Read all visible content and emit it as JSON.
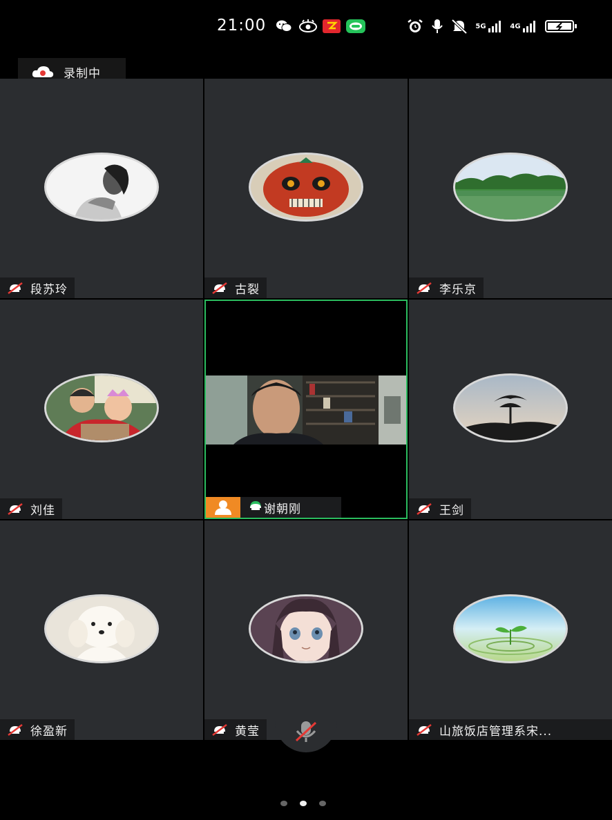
{
  "status_bar": {
    "time": "21:00",
    "network_1": "5G",
    "network_2": "4G"
  },
  "recording": {
    "label": "录制中"
  },
  "tiles": [
    {
      "name": "段苏玲",
      "avatar_icon": "portrait-woman-avatar"
    },
    {
      "name": "古裂",
      "avatar_icon": "tribal-mask-avatar"
    },
    {
      "name": "李乐京",
      "avatar_icon": "lake-landscape-avatar"
    },
    {
      "name": "刘佳",
      "avatar_icon": "children-photo-avatar"
    },
    {
      "name": "谢朝刚",
      "avatar_icon": "live-video"
    },
    {
      "name": "王剑",
      "avatar_icon": "tree-sunset-avatar"
    },
    {
      "name": "徐盈新",
      "avatar_icon": "white-dog-avatar"
    },
    {
      "name": "黄莹",
      "avatar_icon": "anime-girl-avatar"
    },
    {
      "name": "山旅饭店管理系宋...",
      "avatar_icon": "sprout-water-avatar"
    }
  ],
  "pager": {
    "pages": 3,
    "current": 2
  },
  "colors": {
    "tile_bg": "#2b2d30",
    "active_border": "#2bbd5f",
    "host_badge": "#f08a24",
    "muted_red": "#e53935"
  }
}
